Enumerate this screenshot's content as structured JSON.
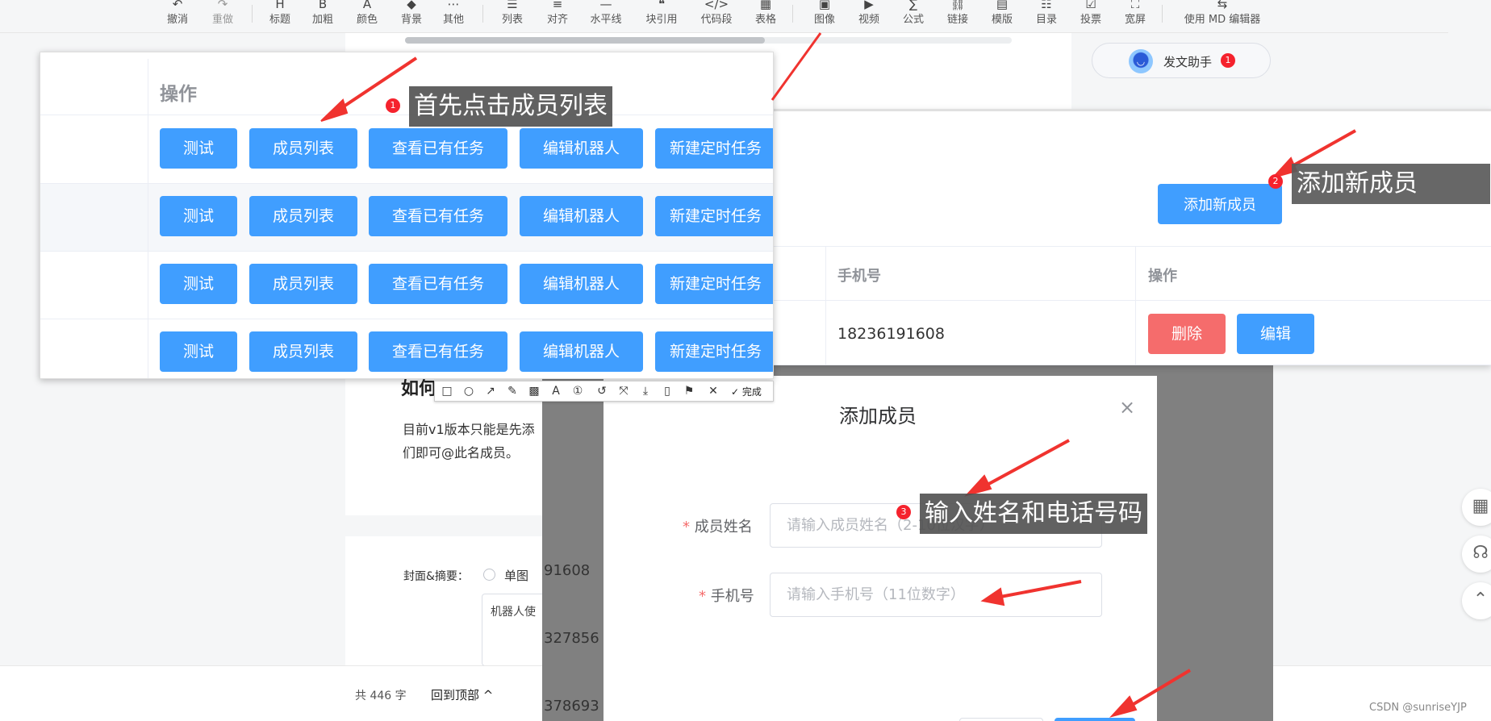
{
  "toolbar": {
    "items": [
      {
        "label": "撤消",
        "icon": "undo-icon",
        "glyph": "↶",
        "disabled": false
      },
      {
        "label": "重做",
        "icon": "redo-icon",
        "glyph": "↷",
        "disabled": true
      },
      {
        "label": "标题",
        "icon": "heading-icon",
        "glyph": "H",
        "disabled": false
      },
      {
        "label": "加粗",
        "icon": "bold-icon",
        "glyph": "B",
        "disabled": false
      },
      {
        "label": "颜色",
        "icon": "text-color-icon",
        "glyph": "A",
        "disabled": false
      },
      {
        "label": "背景",
        "icon": "background-color-icon",
        "glyph": "◆",
        "disabled": false
      },
      {
        "label": "其他",
        "icon": "more-icon",
        "glyph": "⋯",
        "disabled": false
      },
      {
        "label": "列表",
        "icon": "list-icon",
        "glyph": "☰",
        "disabled": false
      },
      {
        "label": "对齐",
        "icon": "align-icon",
        "glyph": "≡",
        "disabled": false
      },
      {
        "label": "水平线",
        "icon": "horizontal-rule-icon",
        "glyph": "—",
        "disabled": false
      },
      {
        "label": "块引用",
        "icon": "blockquote-icon",
        "glyph": "❝",
        "disabled": false
      },
      {
        "label": "代码段",
        "icon": "code-block-icon",
        "glyph": "</>",
        "disabled": false
      },
      {
        "label": "表格",
        "icon": "table-icon",
        "glyph": "▦",
        "disabled": false
      },
      {
        "label": "图像",
        "icon": "image-icon",
        "glyph": "▣",
        "disabled": false
      },
      {
        "label": "视频",
        "icon": "video-icon",
        "glyph": "▶",
        "disabled": false
      },
      {
        "label": "公式",
        "icon": "formula-icon",
        "glyph": "∑",
        "disabled": false
      },
      {
        "label": "链接",
        "icon": "link-icon",
        "glyph": "⛓",
        "disabled": false
      },
      {
        "label": "模版",
        "icon": "template-icon",
        "glyph": "▤",
        "disabled": false
      },
      {
        "label": "目录",
        "icon": "toc-icon",
        "glyph": "☷",
        "disabled": false
      },
      {
        "label": "投票",
        "icon": "vote-icon",
        "glyph": "☑",
        "disabled": false
      },
      {
        "label": "宽屏",
        "icon": "widescreen-icon",
        "glyph": "⛶",
        "disabled": false
      },
      {
        "label": "使用 MD 编辑器",
        "icon": "md-editor-icon",
        "glyph": "⇆",
        "disabled": false
      }
    ]
  },
  "assistant": {
    "label": "发文助手",
    "badge": "1",
    "icon": "assistant-avatar-icon"
  },
  "article": {
    "heading": "如何",
    "body_line1": "目前v1版本只能是先添",
    "body_line2": "们即可@此名成员。"
  },
  "cover": {
    "label": "封面&摘要：",
    "radio_label": "单图",
    "summary_text": "机器人使"
  },
  "footer": {
    "word_count": "共 446 字",
    "back_to_top": "回到顶部",
    "watermark": "CSDN @sunriseYJP"
  },
  "side_buttons": [
    {
      "icon": "qrcode-icon",
      "glyph": "▦"
    },
    {
      "icon": "customer-service-icon",
      "glyph": "☊"
    },
    {
      "icon": "back-to-top-icon",
      "glyph": "⌃"
    }
  ],
  "robot_table": {
    "header_action": "操作",
    "rows": [
      {
        "buttons": [
          "测试",
          "成员列表",
          "查看已有任务",
          "编辑机器人",
          "新建定时任务"
        ]
      },
      {
        "buttons": [
          "测试",
          "成员列表",
          "查看已有任务",
          "编辑机器人",
          "新建定时任务"
        ]
      },
      {
        "buttons": [
          "测试",
          "成员列表",
          "查看已有任务",
          "编辑机器人",
          "新建定时任务"
        ]
      },
      {
        "buttons": [
          "测试",
          "成员列表",
          "查看已有任务",
          "编辑机器人",
          "新建定时任务"
        ]
      }
    ]
  },
  "member_table": {
    "add_button": "添加新成员",
    "col_phone": "手机号",
    "col_action": "操作",
    "rows": [
      {
        "phone": "18236191608",
        "delete": "删除",
        "edit": "编辑"
      }
    ]
  },
  "dialog": {
    "title": "添加成员",
    "close_glyph": "×",
    "name_label": "成员姓名",
    "name_placeholder": "请输入成员姓名（2-10位汉字）",
    "phone_label": "手机号",
    "phone_placeholder": "请输入手机号（11位数字）",
    "required_mark": "*"
  },
  "background_phones": [
    "91608",
    "327856",
    "378693"
  ],
  "snip_toolbar": {
    "tools": [
      {
        "icon": "rectangle-tool-icon",
        "glyph": "□"
      },
      {
        "icon": "ellipse-tool-icon",
        "glyph": "○"
      },
      {
        "icon": "arrow-tool-icon",
        "glyph": "↗"
      },
      {
        "icon": "pen-tool-icon",
        "glyph": "✎"
      },
      {
        "icon": "mosaic-tool-icon",
        "glyph": "▩"
      },
      {
        "icon": "text-tool-icon",
        "glyph": "A"
      },
      {
        "icon": "number-tool-icon",
        "glyph": "①"
      },
      {
        "icon": "undo-tool-icon",
        "glyph": "↺"
      },
      {
        "icon": "crop-tool-icon",
        "glyph": "⤧"
      },
      {
        "icon": "download-tool-icon",
        "glyph": "⤓"
      },
      {
        "icon": "device-tool-icon",
        "glyph": "▯"
      },
      {
        "icon": "pin-tool-icon",
        "glyph": "⚑"
      },
      {
        "icon": "cancel-tool-icon",
        "glyph": "✕"
      }
    ],
    "done_label": "完成"
  },
  "annotations": [
    {
      "number": "1",
      "text": "首先点击成员列表"
    },
    {
      "number": "2",
      "text": "添加新成员"
    },
    {
      "number": "3",
      "text": "输入姓名和电话号码"
    }
  ],
  "colors": {
    "primary": "#409eff",
    "danger": "#f56c6c",
    "arrow": "#f0332f",
    "callout_bg": "#505050"
  }
}
